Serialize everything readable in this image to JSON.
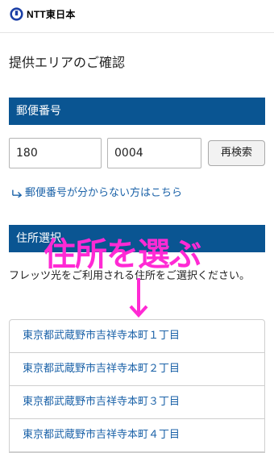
{
  "header": {
    "logo_text": "NTT東日本"
  },
  "page_title": "提供エリアのご確認",
  "postal_section": {
    "heading": "郵便番号",
    "first_value": "180",
    "second_value": "0004",
    "search_button": "再検索",
    "help_link": "郵便番号が分からない方はこちら"
  },
  "address_section": {
    "heading": "住所選択",
    "instruction": "フレッツ光をご利用される住所をご選択ください。",
    "items": [
      "東京都武蔵野市吉祥寺本町１丁目",
      "東京都武蔵野市吉祥寺本町２丁目",
      "東京都武蔵野市吉祥寺本町３丁目",
      "東京都武蔵野市吉祥寺本町４丁目"
    ]
  },
  "annotation": {
    "text": "住所を選ぶ"
  },
  "colors": {
    "brand_blue": "#0a5592",
    "link_blue": "#1b62a8",
    "annotation_pink": "#ff2ad4"
  }
}
